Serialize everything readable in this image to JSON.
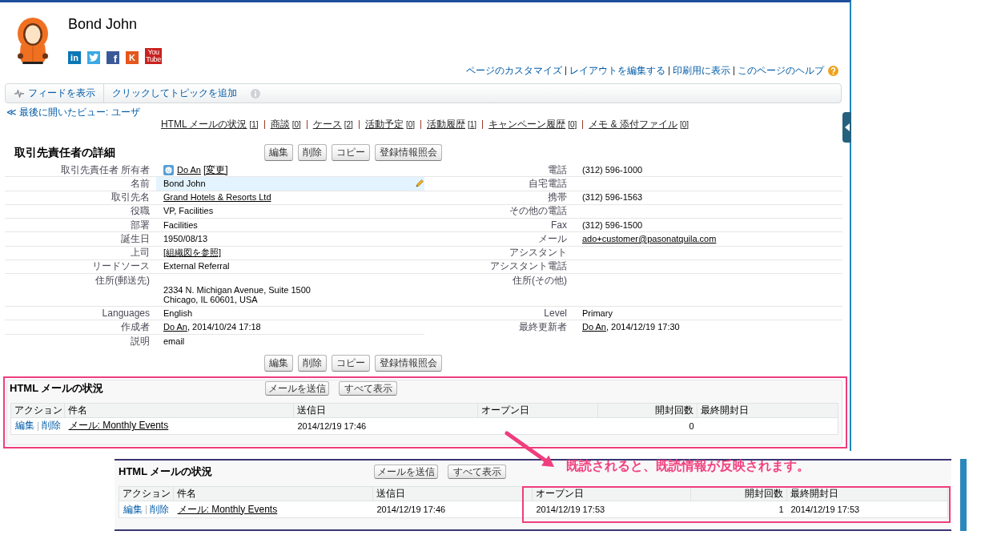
{
  "header": {
    "title": "Bond John",
    "social_links": [
      {
        "kind": "linkedin",
        "label": "in"
      },
      {
        "kind": "twitter"
      },
      {
        "kind": "facebook",
        "label": "f"
      },
      {
        "kind": "klout",
        "label": "K"
      },
      {
        "kind": "youtube",
        "label": "You Tube"
      }
    ],
    "page_links": [
      "ページのカスタマイズ",
      "レイアウトを編集する",
      "印刷用に表示",
      "このページのヘルプ"
    ]
  },
  "feed_bar": {
    "items": [
      {
        "kind": "feed",
        "label": "フィードを表示"
      },
      {
        "kind": "topic",
        "label": "クリックしてトピックを追加"
      }
    ]
  },
  "breadcrumb": "≪ 最後に開いたビュー: ユーザ",
  "related_links": [
    {
      "label": "HTML メールの状況",
      "count": "[1]"
    },
    {
      "label": "商談",
      "count": "[0]"
    },
    {
      "label": "ケース",
      "count": "[2]"
    },
    {
      "label": "活動予定",
      "count": "[0]"
    },
    {
      "label": "活動履歴",
      "count": "[1]"
    },
    {
      "label": "キャンペーン履歴",
      "count": "[0]"
    },
    {
      "label": "メモ & 添付ファイル",
      "count": "[0]"
    }
  ],
  "detail": {
    "title": "取引先責任者の詳細",
    "buttons": [
      "編集",
      "削除",
      "コピー",
      "登録情報照会"
    ],
    "left_fields": [
      {
        "kind": "owner",
        "label": "取引先責任者 所有者",
        "link": "Do An",
        "action": "[変更]",
        "hovered": false
      },
      {
        "kind": "text",
        "label": "名前",
        "value": "Bond John",
        "hovered": true
      },
      {
        "kind": "link",
        "label": "取引先名",
        "value": "Grand Hotels & Resorts Ltd",
        "hovered": false
      },
      {
        "kind": "text",
        "label": "役職",
        "value": "VP, Facilities",
        "hovered": false
      },
      {
        "kind": "text",
        "label": "部署",
        "value": "Facilities",
        "hovered": false
      },
      {
        "kind": "text",
        "label": "誕生日",
        "value": "1950/08/13",
        "hovered": false
      },
      {
        "kind": "link",
        "label": "上司",
        "value": "[組織図を参照]",
        "hovered": false
      },
      {
        "kind": "text",
        "label": "リードソース",
        "value": "External Referral",
        "hovered": false
      },
      {
        "kind": "address",
        "label": "住所(郵送先)",
        "lines": [
          "2334 N. Michigan Avenue, Suite 1500",
          "Chicago, IL 60601, USA"
        ],
        "hovered": false
      },
      {
        "kind": "text",
        "label": "Languages",
        "value": "English",
        "hovered": false
      },
      {
        "kind": "link_with_text",
        "label": "作成者",
        "link": "Do An",
        "value": ", 2014/10/24 17:18",
        "hovered": false
      },
      {
        "kind": "text",
        "label": "説明",
        "value": "email",
        "hovered": false
      }
    ],
    "right_fields": [
      {
        "kind": "text",
        "label": "電話",
        "value": "(312) 596-1000",
        "hovered": false
      },
      {
        "kind": "text",
        "label": "自宅電話",
        "hovered": false
      },
      {
        "kind": "text",
        "label": "携帯",
        "value": "(312) 596-1563",
        "hovered": false
      },
      {
        "kind": "text",
        "label": "その他の電話",
        "hovered": false
      },
      {
        "kind": "text",
        "label": "Fax",
        "value": "(312) 596-1500",
        "hovered": false
      },
      {
        "kind": "link",
        "label": "メール",
        "value": "ado+customer@pasonatquila.com",
        "hovered": false
      },
      {
        "kind": "text",
        "label": "アシスタント",
        "hovered": false
      },
      {
        "kind": "text",
        "label": "アシスタント電話",
        "hovered": false
      },
      {
        "kind": "address",
        "label": "住所(その他)",
        "hovered": false
      },
      {
        "kind": "text",
        "label": "Level",
        "value": "Primary",
        "hovered": false
      },
      {
        "kind": "link_with_text",
        "label": "最終更新者",
        "link": "Do An",
        "value": ", 2014/12/19 17:30",
        "hovered": false
      }
    ],
    "bottom_buttons": [
      "編集",
      "削除",
      "コピー",
      "登録情報照会"
    ]
  },
  "html_email_status": {
    "title": "HTML メールの状況",
    "highlighted": true,
    "buttons": [
      "メールを送信",
      "すべて表示"
    ],
    "columns": [
      {
        "label": "アクション",
        "kind": "actions",
        "highlighted": false
      },
      {
        "label": "件名",
        "kind": "link",
        "highlighted": false
      },
      {
        "label": "送信日",
        "kind": "text",
        "highlighted": false
      },
      {
        "label": "オープン日",
        "kind": "text",
        "highlighted": false
      },
      {
        "label": "開封回数",
        "kind": "number",
        "highlighted": false
      },
      {
        "label": "最終開封日",
        "kind": "text",
        "highlighted": false
      }
    ],
    "rows": [
      {
        "actions": [
          "編集",
          "削除"
        ],
        "subject": "メール: Monthly Events",
        "sent_date": "2014/12/19 17:46",
        "open_count": "0"
      }
    ]
  },
  "callout": {
    "text": "既読されると、既読情報が反映されます。"
  },
  "updated_email_status": {
    "title": "HTML メールの状況",
    "highlighted": false,
    "buttons": [
      "メールを送信",
      "すべて表示"
    ],
    "columns": [
      {
        "label": "アクション",
        "kind": "actions",
        "highlighted": false
      },
      {
        "label": "件名",
        "kind": "link",
        "highlighted": false
      },
      {
        "label": "送信日",
        "kind": "text",
        "highlighted": false
      },
      {
        "label": "オープン日",
        "kind": "text",
        "highlighted": true
      },
      {
        "label": "開封回数",
        "kind": "number",
        "highlighted": true
      },
      {
        "label": "最終開封日",
        "kind": "text",
        "highlighted": true
      }
    ],
    "rows": [
      {
        "actions": [
          "編集",
          "削除"
        ],
        "subject": "メール: Monthly Events",
        "sent_date": "2014/12/19 17:46",
        "open_date": "2014/12/19 17:53",
        "open_count": "1",
        "last_open_date": "2014/12/19 17:53"
      }
    ]
  }
}
